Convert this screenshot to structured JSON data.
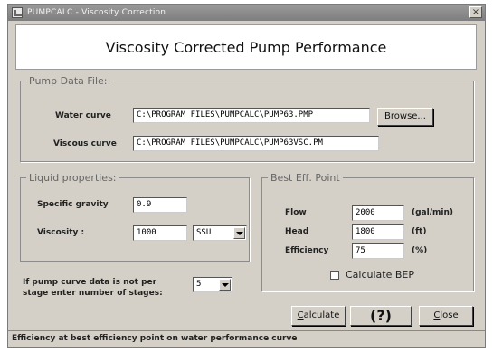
{
  "window": {
    "title": "PUMPCALC - Viscosity Correction",
    "close_glyph": "×",
    "heading": "Viscosity Corrected Pump Performance"
  },
  "pump_data": {
    "legend": "Pump Data File:",
    "water_label": "Water curve",
    "water_value": "C:\\PROGRAM FILES\\PUMPCALC\\PUMP63.PMP",
    "browse_label": "Browse...",
    "viscous_label": "Viscous curve",
    "viscous_value": "C:\\PROGRAM FILES\\PUMPCALC\\PUMP63VSC.PM"
  },
  "liquid": {
    "legend": "Liquid properties:",
    "sg_label": "Specific gravity",
    "sg_value": "0.9",
    "visc_label": "Viscosity :",
    "visc_value": "1000",
    "visc_unit": "SSU"
  },
  "bep": {
    "legend": "Best Eff. Point",
    "flow_label": "Flow",
    "flow_value": "2000",
    "flow_unit": "(gal/min)",
    "head_label": "Head",
    "head_value": "1800",
    "head_unit": "(ft)",
    "eff_label": "Efficiency",
    "eff_value": "75",
    "eff_unit": "(%)",
    "calc_bep_label": "Calculate BEP",
    "calc_bep_checked": false
  },
  "stages": {
    "prompt_line1": "If pump curve data is not per",
    "prompt_line2": "stage enter number of stages:",
    "value": "5"
  },
  "buttons": {
    "calculate_first": "C",
    "calculate_rest": "alculate",
    "help": "(?)",
    "close_first": "C",
    "close_rest": "lose"
  },
  "status": "Efficiency at best efficiency point on water performance curve"
}
